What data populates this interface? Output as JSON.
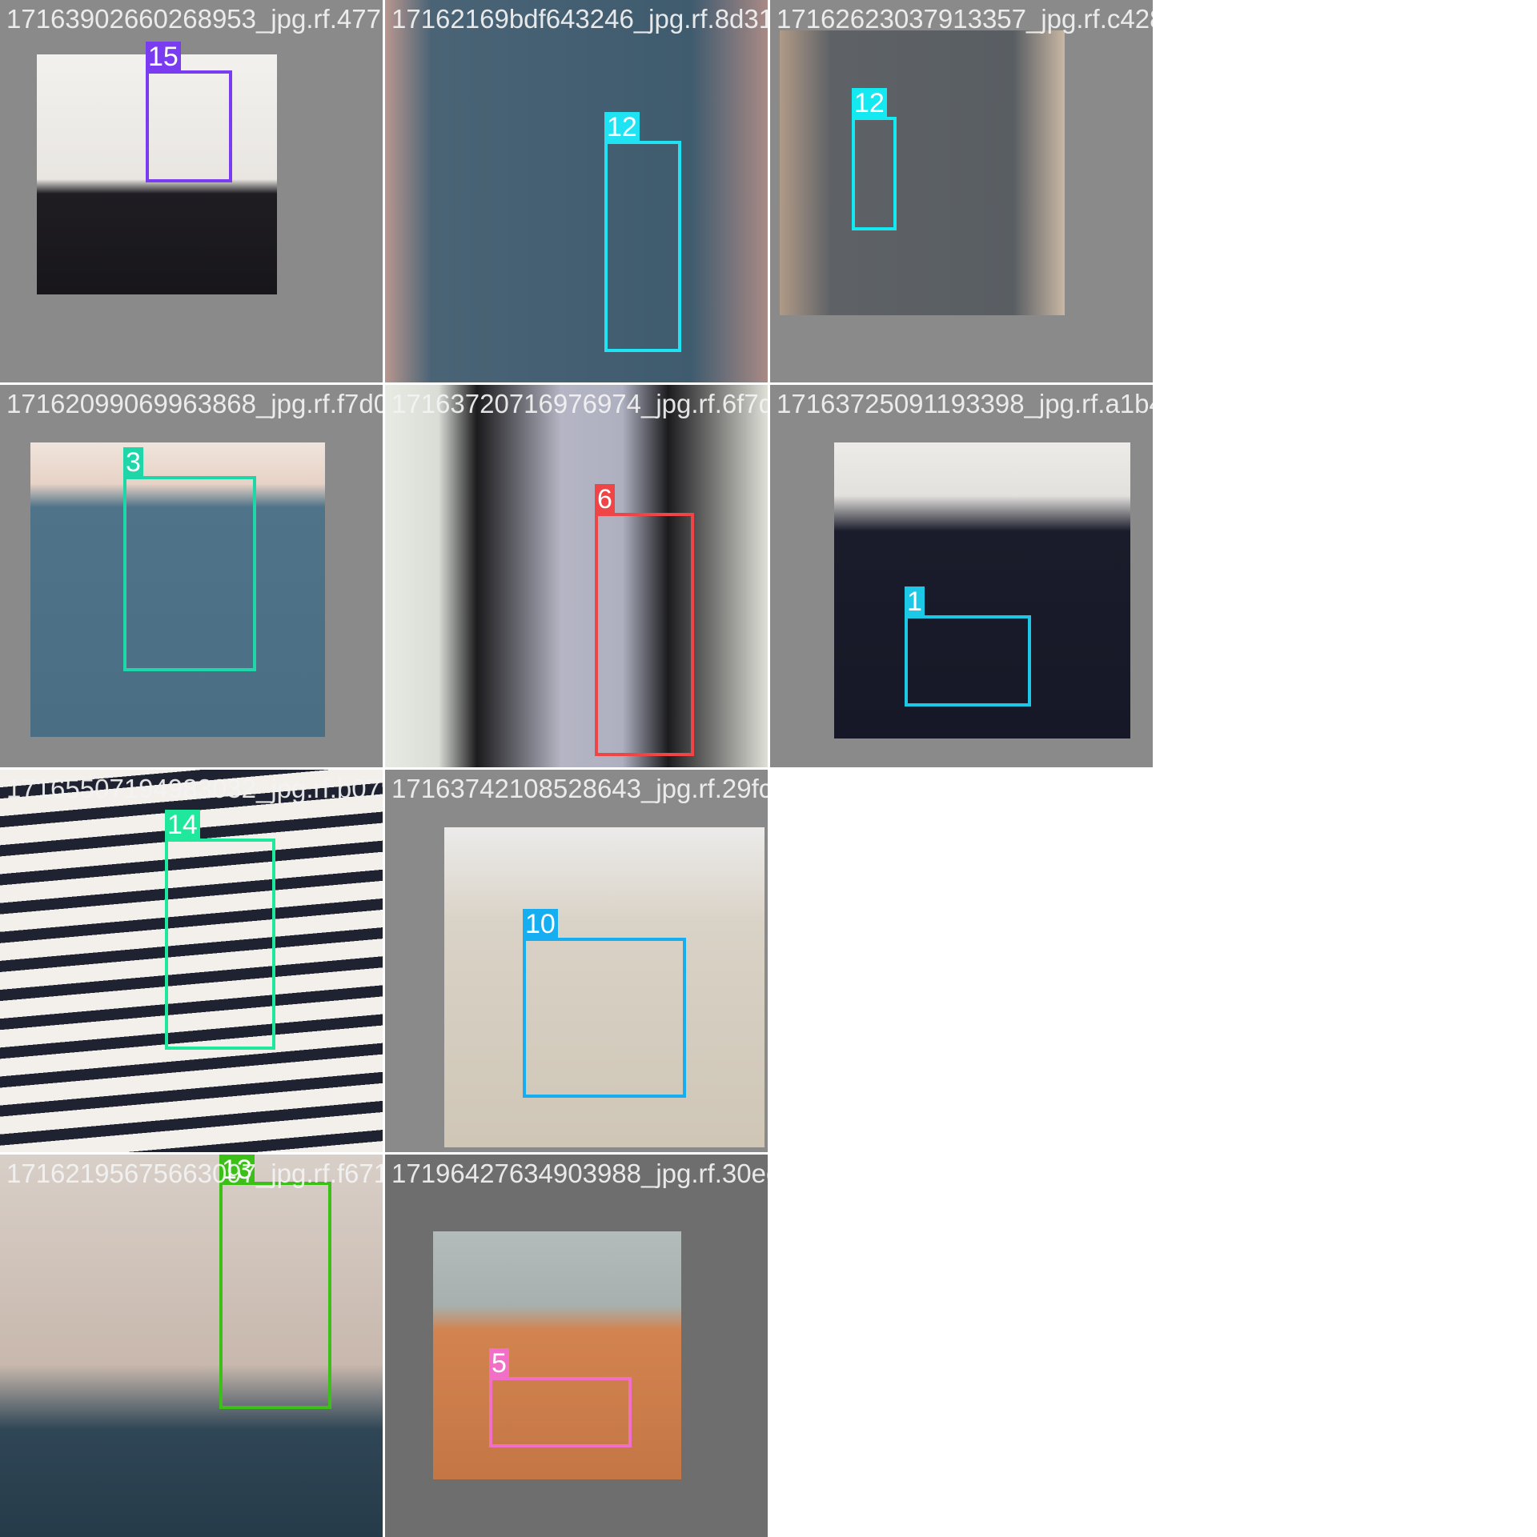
{
  "tiles": [
    {
      "filename": "17163902660268953_jpg.rf.477132176e1fec3",
      "label": "15",
      "color": "#7a3cf0"
    },
    {
      "filename": "17162169bdf643246_jpg.rf.8d3165213f6739e2",
      "label": "12",
      "color": "#1fe2f2"
    },
    {
      "filename": "17162623037913357_jpg.rf.c428958dee314b9",
      "label": "12",
      "color": "#14e9f2"
    },
    {
      "filename": "17162099069963868_jpg.rf.f7d0547001f6d3a",
      "label": "3",
      "color": "#1fd6a8"
    },
    {
      "filename": "17163720716976974_jpg.rf.6f7d0832f99d1f2e",
      "label": "6",
      "color": "#ef4547"
    },
    {
      "filename": "17163725091193398_jpg.rf.a1b4946847a7f61",
      "label": "1",
      "color": "#1cc8e6"
    },
    {
      "filename": "17165507194983032_jpg.rf.b0796d7d6882ddd6",
      "label": "14",
      "color": "#1fe89c"
    },
    {
      "filename": "17163742108528643_jpg.rf.29fceb71dc4fcca",
      "label": "10",
      "color": "#16aef0"
    },
    {
      "filename": "17162195675663097_jpg.rf.f671c0642f6c3f43",
      "label": "13",
      "color": "#3cbf17"
    },
    {
      "filename": "17196427634903988_jpg.rf.30ec094c3796272",
      "label": "5",
      "color": "#f26fc7"
    }
  ]
}
